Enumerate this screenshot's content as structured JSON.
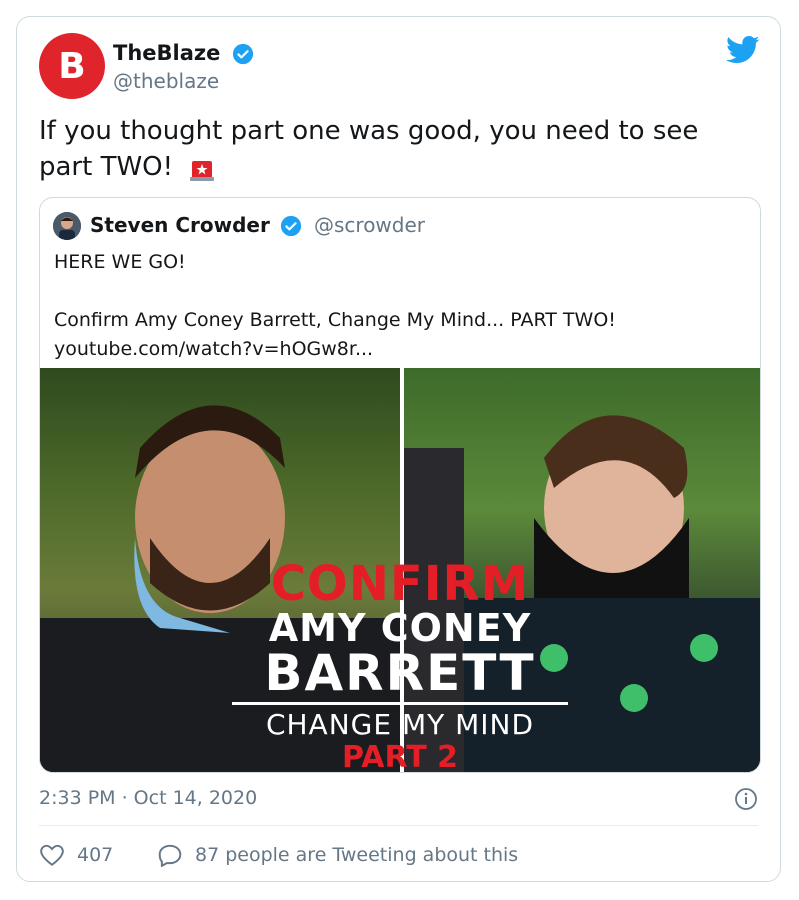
{
  "author": {
    "name": "TheBlaze",
    "handle": "@theblaze",
    "avatar_letter": "B",
    "brand_color": "#e0242b"
  },
  "tweet": {
    "text": "If you thought part one was good, you need to see part TWO!",
    "emoji": "siren-icon"
  },
  "quoted": {
    "name": "Steven Crowder",
    "handle": "@scrowder",
    "text": "HERE WE GO!\n\nConfirm Amy Coney Barrett, Change My Mind... PART TWO!\nyoutube.com/watch?v=hOGw8r..."
  },
  "thumbnail": {
    "line1": "CONFIRM",
    "line2": "AMY CONEY",
    "line3": "BARRETT",
    "line4": "CHANGE MY MIND",
    "line5": "PART 2"
  },
  "meta": {
    "timestamp": "2:33 PM · Oct 14, 2020",
    "likes": "407",
    "replies": "87 people are Tweeting about this"
  },
  "colors": {
    "twitter_blue": "#1da1f2",
    "verified_blue": "#1da1f2",
    "muted": "#657786"
  }
}
